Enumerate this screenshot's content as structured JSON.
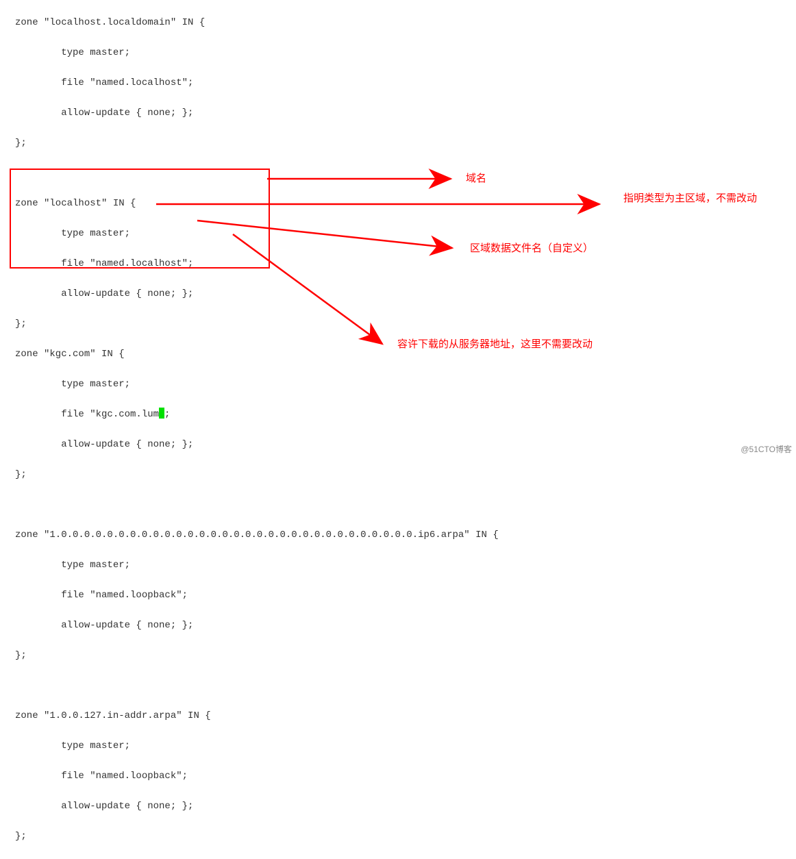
{
  "code": {
    "line1": "zone \"localhost.localdomain\" IN {",
    "line2": "        type master;",
    "line3": "        file \"named.localhost\";",
    "line4": "        allow-update { none; };",
    "line5": "};",
    "line6": "",
    "line7": "zone \"localhost\" IN {",
    "line8": "        type master;",
    "line9": "        file \"named.localhost\";",
    "line10": "        allow-update { none; };",
    "line11": "};",
    "line12": "zone \"kgc.com\" IN {",
    "line13": "        type master;",
    "line14_pre": "        file \"kgc.com.lum",
    "line14_post": ";",
    "line15": "        allow-update { none; };",
    "line16": "};",
    "line17": "",
    "line18": "zone \"1.0.0.0.0.0.0.0.0.0.0.0.0.0.0.0.0.0.0.0.0.0.0.0.0.0.0.0.0.0.0.0.ip6.arpa\" IN {",
    "line19": "        type master;",
    "line20": "        file \"named.loopback\";",
    "line21": "        allow-update { none; };",
    "line22": "};",
    "line23": "",
    "line24": "zone \"1.0.0.127.in-addr.arpa\" IN {",
    "line25": "        type master;",
    "line26": "        file \"named.loopback\";",
    "line27": "        allow-update { none; };",
    "line28": "};"
  },
  "annotations": {
    "a1": "域名",
    "a2": "指明类型为主区域，不需改动",
    "a3": "区域数据文件名（自定义）",
    "a4": "容许下载的从服务器地址，这里不需要改动"
  },
  "watermark": "@51CTO博客"
}
